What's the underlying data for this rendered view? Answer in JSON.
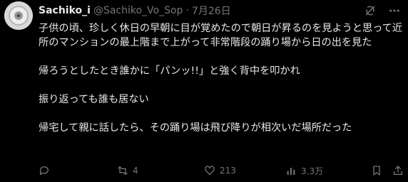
{
  "post": {
    "display_name": "Sachiko_i",
    "handle": "@Sachiko_Vo_Sop",
    "separator": "·",
    "date": "7月26日",
    "paragraphs": [
      "子供の頃、珍しく休日の早朝に目が覚めたので朝日が昇るのを見ようと思って近所のマンションの最上階まで上がって非常階段の踊り場から日の出を見た",
      "帰ろうとしたとき誰かに「パンッ!!」と強く背中を叩かれ",
      "振り返っても誰も居ない",
      "帰宅して親に話したら、その踊り場は飛び降りが相次いだ場所だった"
    ],
    "stats": {
      "reposts": "4",
      "likes": "213",
      "views": "3.3万"
    }
  },
  "icons": {
    "grok": "grok-icon",
    "more": "more-icon",
    "reply": "reply-icon",
    "repost": "repost-icon",
    "like": "heart-icon",
    "views": "views-icon",
    "bookmark": "bookmark-icon",
    "share": "share-icon"
  },
  "colors": {
    "background": "#000000",
    "text": "#e7e9ea",
    "muted": "#71767b"
  }
}
